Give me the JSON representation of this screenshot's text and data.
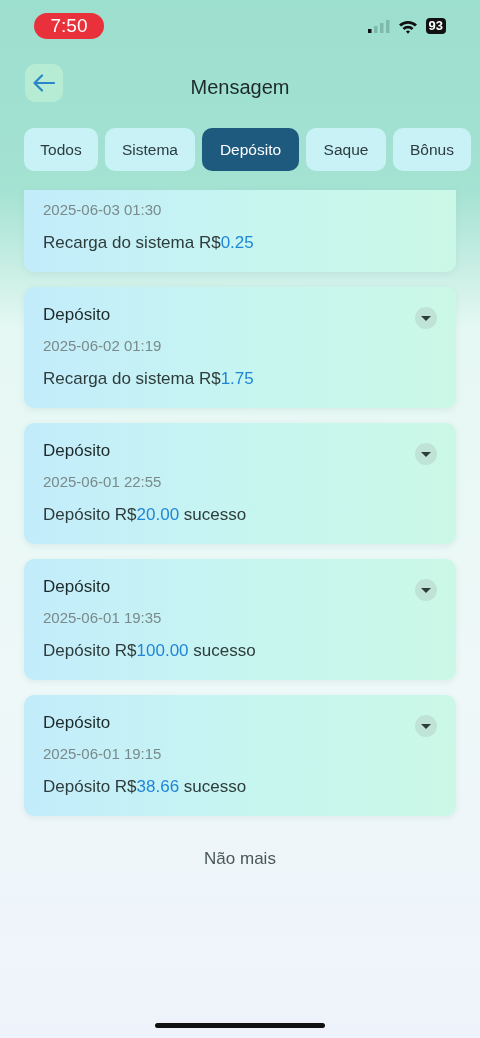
{
  "status_bar": {
    "time": "7:50",
    "battery": "93"
  },
  "header": {
    "title": "Mensagem"
  },
  "tabs": [
    {
      "label": "Todos",
      "selected": false
    },
    {
      "label": "Sistema",
      "selected": false
    },
    {
      "label": "Depósito",
      "selected": true
    },
    {
      "label": "Saque",
      "selected": false
    },
    {
      "label": "Bônus",
      "selected": false
    }
  ],
  "messages": [
    {
      "date": "2025-06-03 01:30",
      "text": "Recarga do sistema R$",
      "amount": "0.25"
    },
    {
      "title": "Depósito",
      "date": "2025-06-02 01:19",
      "text": "Recarga do sistema R$",
      "amount": "1.75"
    },
    {
      "title": "Depósito",
      "date": "2025-06-01 22:55",
      "text": "Depósito R$",
      "amount": "20.00",
      "suffix": "sucesso"
    },
    {
      "title": "Depósito",
      "date": "2025-06-01 19:35",
      "text": "Depósito R$",
      "amount": "100.00",
      "suffix": "sucesso"
    },
    {
      "title": "Depósito",
      "date": "2025-06-01 19:15",
      "text": "Depósito R$",
      "amount": "38.66",
      "suffix": "sucesso"
    }
  ],
  "footer": {
    "text": "Não mais"
  }
}
